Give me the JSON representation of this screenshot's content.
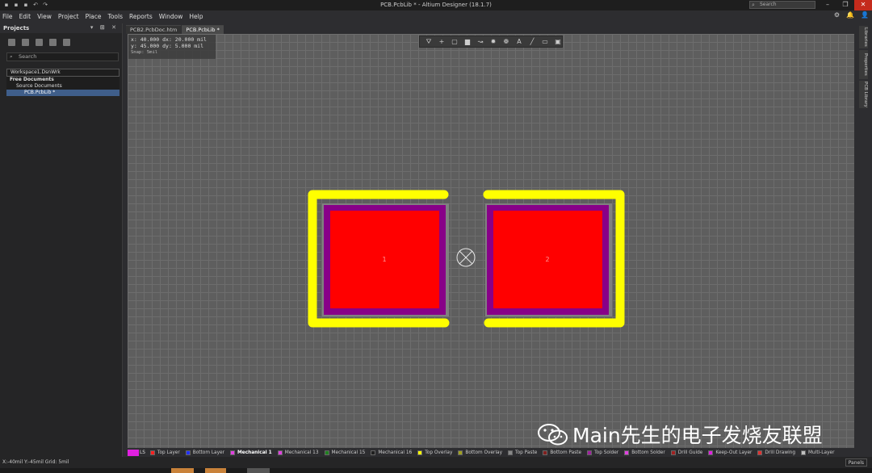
{
  "window": {
    "title": "PCB.PcbLib * - Altium Designer (18.1.7)",
    "search_placeholder": "Search"
  },
  "menu": [
    "File",
    "Edit",
    "View",
    "Project",
    "Place",
    "Tools",
    "Reports",
    "Window",
    "Help"
  ],
  "projects_panel": {
    "title": "Projects",
    "search_placeholder": "Search",
    "tree": {
      "workspace": "Workspace1.DsnWrk",
      "free_docs": "Free Documents",
      "source_docs": "Source Documents",
      "file": "PCB.PcbLib *"
    }
  },
  "tabs": [
    {
      "label": "PCB2.PcbDoc.htm",
      "active": false
    },
    {
      "label": "PCB.PcbLib *",
      "active": true
    }
  ],
  "coords_overlay": {
    "x_line": "x:  40.000  dx:  20.000  mil",
    "y_line": "y:  45.000  dy:   5.000  mil",
    "snap_line": "Snap: 5mil"
  },
  "toolbar_icons": [
    "filter-icon",
    "plus-icon",
    "select-rect-icon",
    "chart-icon",
    "route-icon",
    "pad-icon",
    "via-icon",
    "text-icon",
    "line-icon",
    "component-icon",
    "window-icon"
  ],
  "toolbar_glyphs": [
    "⛛",
    "+",
    "▢",
    "▆",
    "↝",
    "✹",
    "❁",
    "A",
    "╱",
    "▭",
    "▣"
  ],
  "footprint": {
    "pad1_label": "1",
    "pad2_label": "2"
  },
  "right_panels": [
    "Libraries",
    "Properties",
    "PCB Library"
  ],
  "layer_bar": {
    "current": "LS",
    "layers": [
      {
        "name": "Top Layer",
        "color": "#ff2020",
        "active": false
      },
      {
        "name": "Bottom Layer",
        "color": "#2030ff",
        "active": false
      },
      {
        "name": "Mechanical 1",
        "color": "#e040e0",
        "active": true
      },
      {
        "name": "Mechanical 13",
        "color": "#e040e0",
        "active": false
      },
      {
        "name": "Mechanical 15",
        "color": "#208020",
        "active": false
      },
      {
        "name": "Mechanical 16",
        "color": "#202020",
        "active": false
      },
      {
        "name": "Top Overlay",
        "color": "#ffff00",
        "active": false
      },
      {
        "name": "Bottom Overlay",
        "color": "#a0a020",
        "active": false
      },
      {
        "name": "Top Paste",
        "color": "#888888",
        "active": false
      },
      {
        "name": "Bottom Paste",
        "color": "#802020",
        "active": false
      },
      {
        "name": "Top Solder",
        "color": "#a020a0",
        "active": false
      },
      {
        "name": "Bottom Solder",
        "color": "#e040e0",
        "active": false
      },
      {
        "name": "Drill Guide",
        "color": "#a02020",
        "active": false
      },
      {
        "name": "Keep-Out Layer",
        "color": "#e020e0",
        "active": false
      },
      {
        "name": "Drill Drawing",
        "color": "#e03030",
        "active": false
      },
      {
        "name": "Multi-Layer",
        "color": "#c0c0c0",
        "active": false
      }
    ]
  },
  "status": {
    "text": "X:-40mil Y:-45mil   Grid: 5mil",
    "panels_button": "Panels"
  },
  "watermark": "Main先生的电子发烧友联盟"
}
